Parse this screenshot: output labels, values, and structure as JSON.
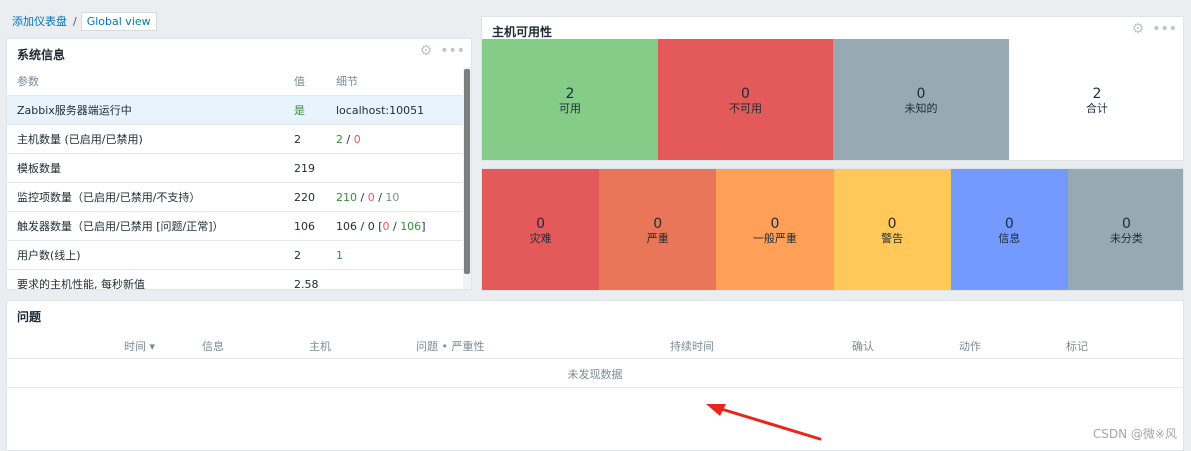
{
  "breadcrumb": {
    "parent": "添加仪表盘",
    "separator": "/",
    "current": "Global view"
  },
  "sysinfo": {
    "title": "系统信息",
    "headers": {
      "param": "参数",
      "value": "值",
      "detail": "细节"
    },
    "rows": [
      {
        "param": "Zabbix服务器端运行中",
        "value": "是",
        "detail": "localhost:10051"
      },
      {
        "param": "主机数量 (已启用/已禁用)",
        "value": "2",
        "d1": "2",
        "sep1": " / ",
        "d2": "0"
      },
      {
        "param": "模板数量",
        "value": "219",
        "detail": ""
      },
      {
        "param": "监控项数量（已启用/已禁用/不支持）",
        "value": "220",
        "d1": "210",
        "sep1": " / ",
        "d2": "0",
        "sep2": " / ",
        "d3": "10"
      },
      {
        "param": "触发器数量（已启用/已禁用 [问题/正常]）",
        "value": "106",
        "d0": "106 / 0 [",
        "d1": "0",
        "sep1": " / ",
        "d2": "106",
        "d3": "]"
      },
      {
        "param": "用户数(线上)",
        "value": "2",
        "detail": "1"
      },
      {
        "param": "要求的主机性能, 每秒新值",
        "value": "2.58",
        "detail": ""
      }
    ]
  },
  "hostavail": {
    "title": "主机可用性",
    "cells": [
      {
        "count": "2",
        "label": "可用",
        "color": "#86cc89"
      },
      {
        "count": "0",
        "label": "不可用",
        "color": "#e45959"
      },
      {
        "count": "0",
        "label": "未知的",
        "color": "#97aab3"
      },
      {
        "count": "2",
        "label": "合计",
        "color": "#ffffff"
      }
    ]
  },
  "severity": {
    "cells": [
      {
        "count": "0",
        "label": "灾难",
        "color": "#e45959"
      },
      {
        "count": "0",
        "label": "严重",
        "color": "#e97659"
      },
      {
        "count": "0",
        "label": "一般严重",
        "color": "#ffa059"
      },
      {
        "count": "0",
        "label": "警告",
        "color": "#ffc859"
      },
      {
        "count": "0",
        "label": "信息",
        "color": "#7499ff"
      },
      {
        "count": "0",
        "label": "未分类",
        "color": "#97aab3"
      }
    ]
  },
  "problems": {
    "title": "问题",
    "headers": {
      "time": "时间 ▾",
      "info": "信息",
      "host": "主机",
      "problem": "问题 • 严重性",
      "duration": "持续时间",
      "ack": "确认",
      "actions": "动作",
      "tags": "标记"
    },
    "empty": "未发现数据"
  },
  "watermark": "CSDN @微※风"
}
